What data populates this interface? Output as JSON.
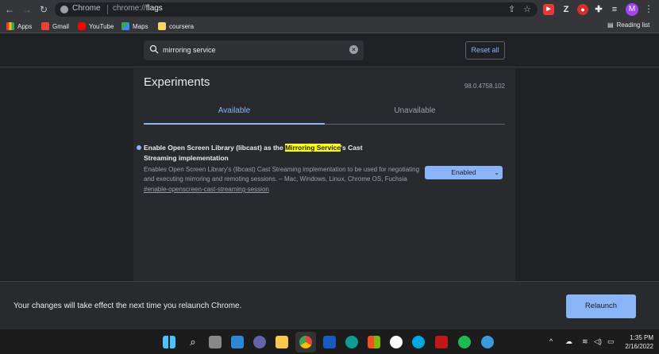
{
  "browser": {
    "omnibox": {
      "site_label": "Chrome",
      "url_scheme": "chrome://",
      "url_path": "flags"
    },
    "profile_initial": "M"
  },
  "bookmarks": {
    "items": [
      {
        "label": "Apps",
        "icon": "apps-grid-icon",
        "color": "#ea4335"
      },
      {
        "label": "Gmail",
        "icon": "gmail-icon",
        "color": "#ea4335"
      },
      {
        "label": "YouTube",
        "icon": "youtube-icon",
        "color": "#ff0000"
      },
      {
        "label": "Maps",
        "icon": "maps-icon",
        "color": "#34a853"
      },
      {
        "label": "coursera",
        "icon": "folder-icon",
        "color": "#fdd663"
      }
    ],
    "reading_list": "Reading list"
  },
  "flags": {
    "search": {
      "value": "mirroring service"
    },
    "reset_all": "Reset all",
    "title": "Experiments",
    "version": "98.0.4758.102",
    "tabs": [
      {
        "label": "Available",
        "active": true
      },
      {
        "label": "Unavailable",
        "active": false
      }
    ],
    "experiment": {
      "title_before": "Enable Open Screen Library (libcast) as the ",
      "title_highlight": "Mirroring Service",
      "title_after": "'s Cast Streaming implementation",
      "description": "Enables Open Screen Library's (libcast) Cast Streaming implementation to be used for negotiating and executing mirroring and remoting sessions. – Mac, Windows, Linux, Chrome OS, Fuchsia",
      "link": "#enable-openscreen-cast-streaming-session",
      "state": "Enabled"
    }
  },
  "relaunch": {
    "message": "Your changes will take effect the next time you relaunch Chrome.",
    "button": "Relaunch"
  },
  "taskbar": {
    "time": "1:35 PM",
    "date": "2/16/2022"
  },
  "colors": {
    "accent": "#8ab4f8",
    "highlight": "#ffff00",
    "background": "#202124",
    "panel": "#292a2d"
  }
}
